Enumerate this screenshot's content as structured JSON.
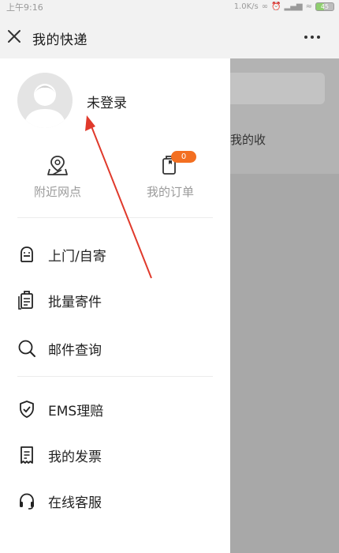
{
  "status_bar": {
    "time": "上午9:16",
    "net_speed": "1.0K/s",
    "battery_level": "45"
  },
  "header": {
    "title": "我的快递"
  },
  "background": {
    "partial_text": "我的收"
  },
  "drawer": {
    "login_status": "未登录",
    "quick_actions": [
      {
        "label": "附近网点",
        "icon": "map-pin-icon"
      },
      {
        "label": "我的订单",
        "icon": "clipboard-icon",
        "badge": "0"
      }
    ],
    "menu_items": [
      {
        "label": "上门/自寄",
        "icon": "courier-icon"
      },
      {
        "label": "批量寄件",
        "icon": "batch-send-icon"
      },
      {
        "label": "邮件查询",
        "icon": "search-icon"
      },
      {
        "label": "EMS理赔",
        "icon": "shield-check-icon"
      },
      {
        "label": "我的发票",
        "icon": "receipt-icon"
      },
      {
        "label": "在线客服",
        "icon": "headset-icon"
      }
    ]
  },
  "colors": {
    "badge": "#f36f21",
    "annotation_arrow": "#e0392b",
    "overlay": "#a8a8a8"
  }
}
